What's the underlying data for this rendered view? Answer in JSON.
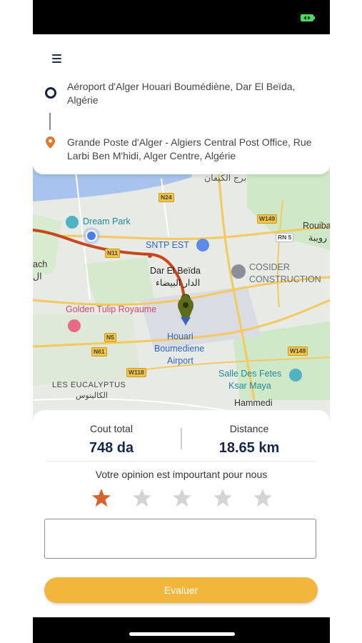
{
  "route": {
    "origin": "Aéroport d'Alger Houari Boumédiène, Dar El Beïda, Algérie",
    "destination": "Grande Poste d'Alger - Algiers Central Post Office, Rue Larbi Ben M'hidi, Alger Centre, Algérie"
  },
  "map": {
    "places": {
      "burj_kiffan": "برج الكيفان",
      "dream_park": "Dream Park",
      "sntp_est": "SNTP EST",
      "rouiba": "Rouiba",
      "rouiba_ar": "رويبة",
      "beach": "ach",
      "beach_ar": "ال",
      "dar_el_beida": "Dar El Beïda",
      "dar_el_beida_ar": "الدار البيضاء",
      "cosider_1": "COSIDER",
      "cosider_2": "CONSTRUCTION",
      "golden_tulip": "Golden Tulip Royaume",
      "airport_1": "Houari",
      "airport_2": "Boumediene",
      "airport_3": "Airport",
      "eucalyptus": "LES EUCALYPTUS",
      "eucalyptus_ar": "الكاليتوس",
      "salle_fetes_1": "Salle Des Fetes",
      "salle_fetes_2": "Ksar Maya",
      "hammedi": "Hammedi"
    },
    "roads": {
      "n24": "N24",
      "w149_top": "W149",
      "rn5": "RN 5",
      "n11": "N11",
      "n5": "N5",
      "n61": "N61",
      "w118": "W118",
      "w149_bottom": "W149"
    }
  },
  "summary": {
    "cost_label": "Cout total",
    "cost_value": "748 da",
    "distance_label": "Distance",
    "distance_value": "18.65 km"
  },
  "rating": {
    "prompt": "Votre opinion est impourtant pour nous",
    "selected": 1,
    "max": 5,
    "active_color": "#d9622b",
    "inactive_color": "#d4d4d4"
  },
  "comment": {
    "value": ""
  },
  "actions": {
    "evaluate_label": "Evaluer"
  },
  "colors": {
    "accent": "#f2b63c",
    "navy": "#16284a",
    "route": "#c9451c",
    "battery": "#4cd964"
  }
}
